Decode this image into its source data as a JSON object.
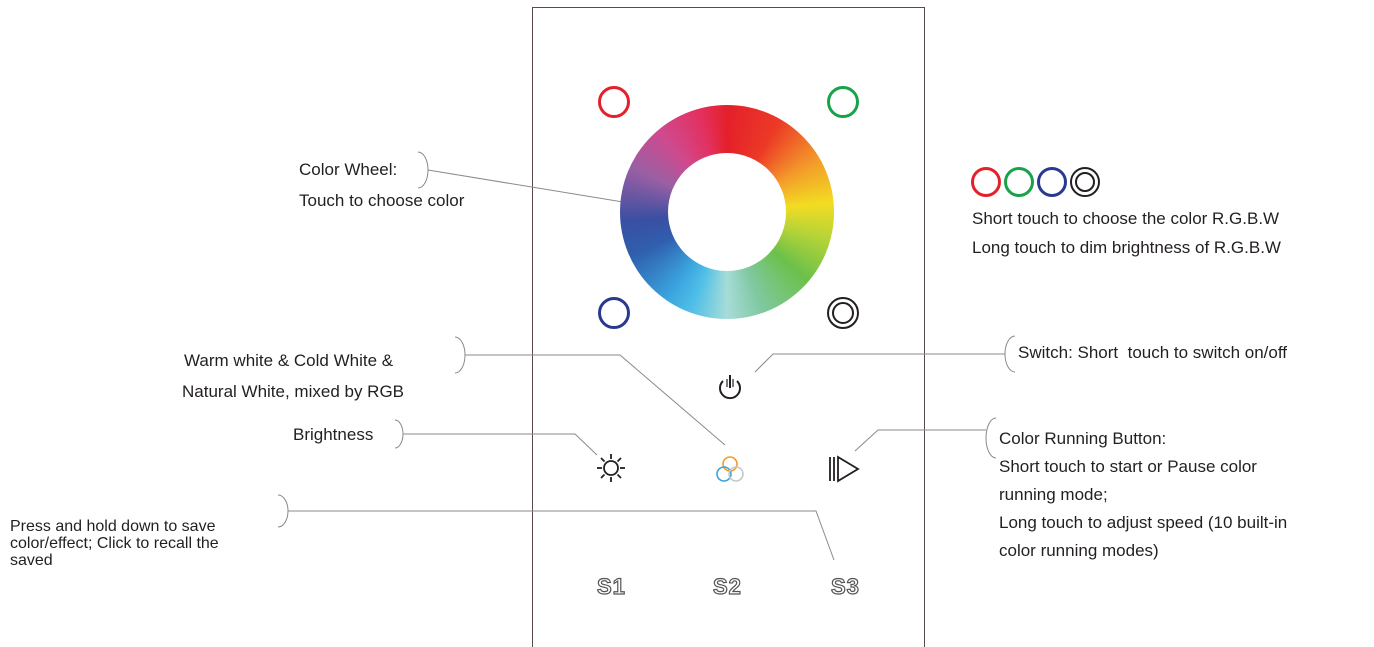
{
  "labels": {
    "color_wheel_line1": "Color Wheel:",
    "color_wheel_line2": "Touch to choose color",
    "rgbw_line1": "Short touch to choose the color R.G.B.W",
    "rgbw_line2": "Long touch to dim brightness of R.G.B.W",
    "white_line1": "Warm white & Cold White &",
    "white_line2": "Natural White, mixed by RGB",
    "switch": "Switch: Short  touch to switch on/off",
    "brightness": "Brightness",
    "running_line1": "Color Running Button:",
    "running_line2": "Short touch to start or Pause color",
    "running_line3": "running mode;",
    "running_line4": "Long touch to adjust speed (10 built-in",
    "running_line5": "color running modes)",
    "save_line1": "Press and hold down to save",
    "save_line2": "color/effect; Click to recall the",
    "save_line3": "saved"
  },
  "scene_buttons": {
    "s1": "S1",
    "s2": "S2",
    "s3": "S3"
  },
  "colors": {
    "red": "#e4202a",
    "green": "#1aa24a",
    "blue": "#2a3990",
    "white_ring": "#231f20",
    "callout_line": "#8a8a8a",
    "panel_border": "#5a4a4a"
  },
  "icons": [
    "power-icon",
    "brightness-icon",
    "rgb-mix-icon",
    "play-pause-icon"
  ]
}
